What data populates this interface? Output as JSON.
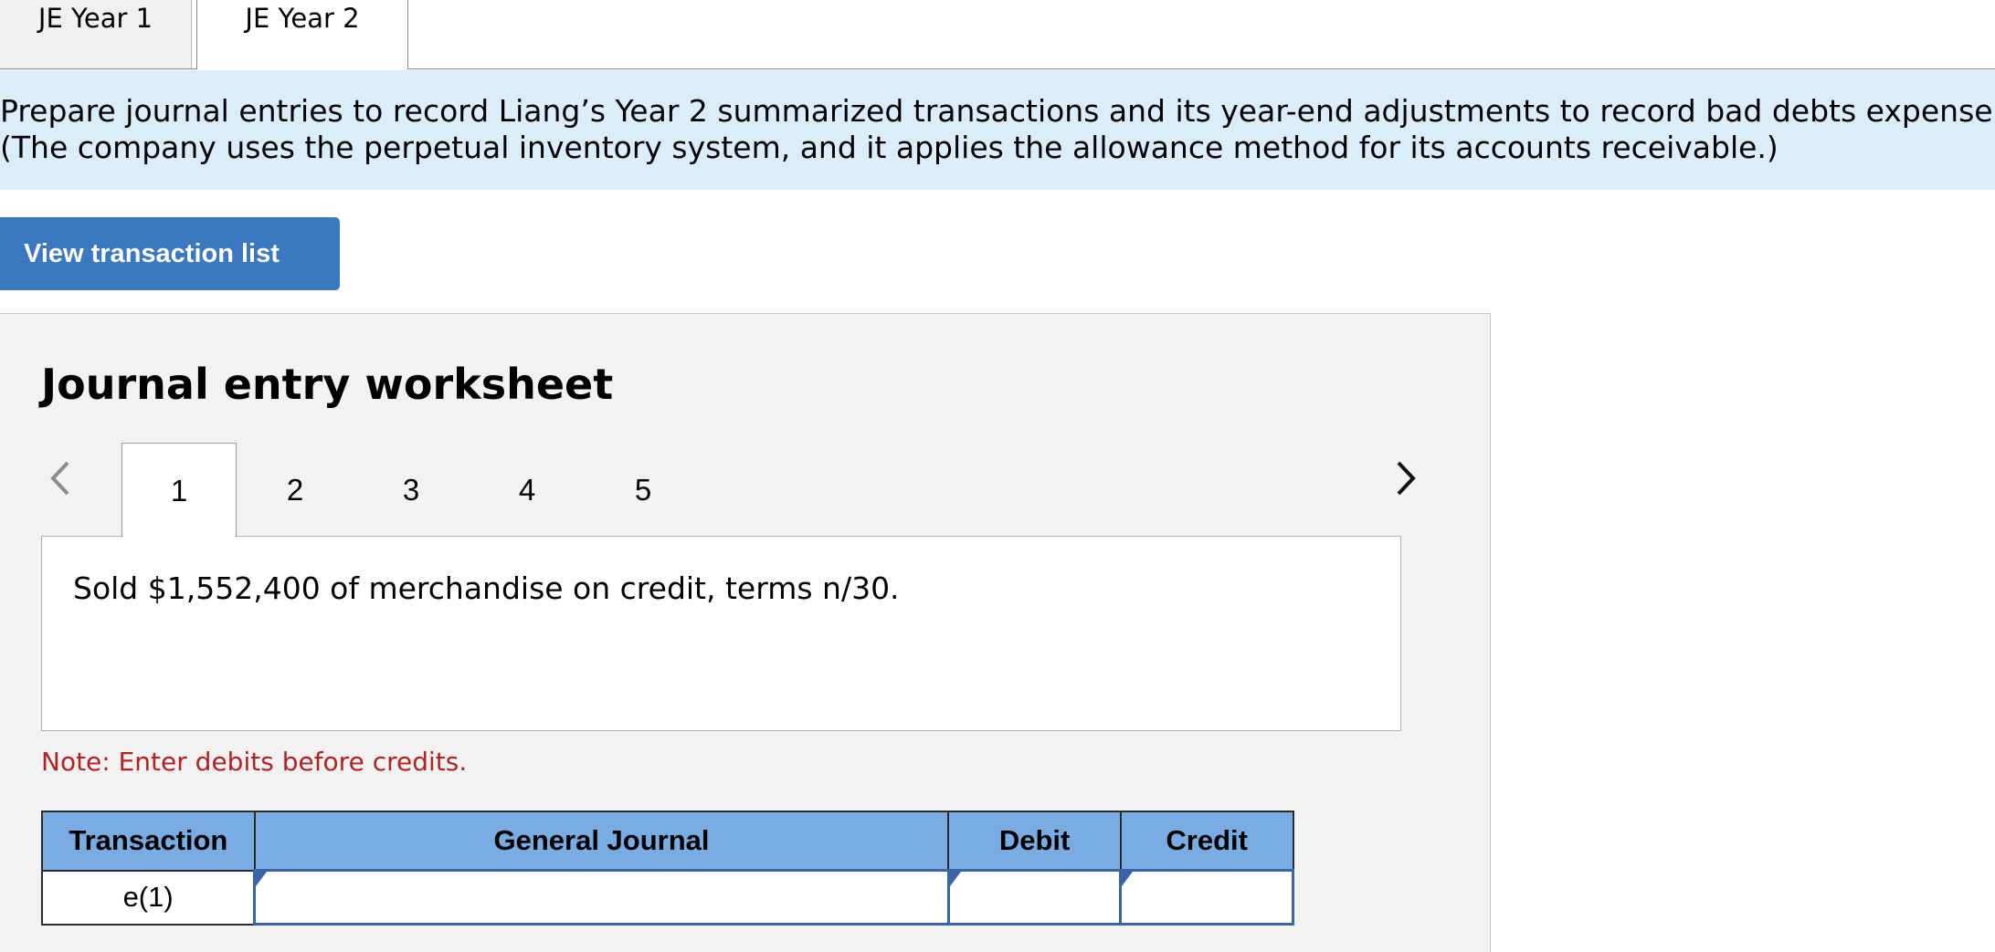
{
  "top_tabs": [
    {
      "label": "JE Year 1",
      "active": false
    },
    {
      "label": "JE Year 2",
      "active": true
    }
  ],
  "instructions": {
    "line1": "Prepare journal entries to record Liang’s Year 2 summarized transactions and its year-end adjustments to record bad debts expense.",
    "line2": "(The company uses the perpetual inventory system, and it applies the allowance method for its accounts receivable.)"
  },
  "view_button": {
    "label": "View transaction list"
  },
  "worksheet": {
    "title": "Journal entry worksheet",
    "steps": [
      "1",
      "2",
      "3",
      "4",
      "5"
    ],
    "active_step": "1",
    "description": "Sold $1,552,400 of merchandise on credit, terms n/30.",
    "note": "Note: Enter debits before credits."
  },
  "table": {
    "headers": [
      "Transaction",
      "General Journal",
      "Debit",
      "Credit"
    ],
    "rows": [
      {
        "transaction": "e(1)",
        "account": "",
        "debit": "",
        "credit": ""
      }
    ]
  },
  "colors": {
    "instructions_bg": "#dcedfa",
    "button_bg": "#3a78bf",
    "worksheet_bg": "#f2f2f2",
    "header_bg": "#7aace4",
    "note_color": "#b32121",
    "input_border": "#3a64a8"
  },
  "icons": {
    "prev": "chevron-left-icon",
    "next": "chevron-right-icon"
  }
}
